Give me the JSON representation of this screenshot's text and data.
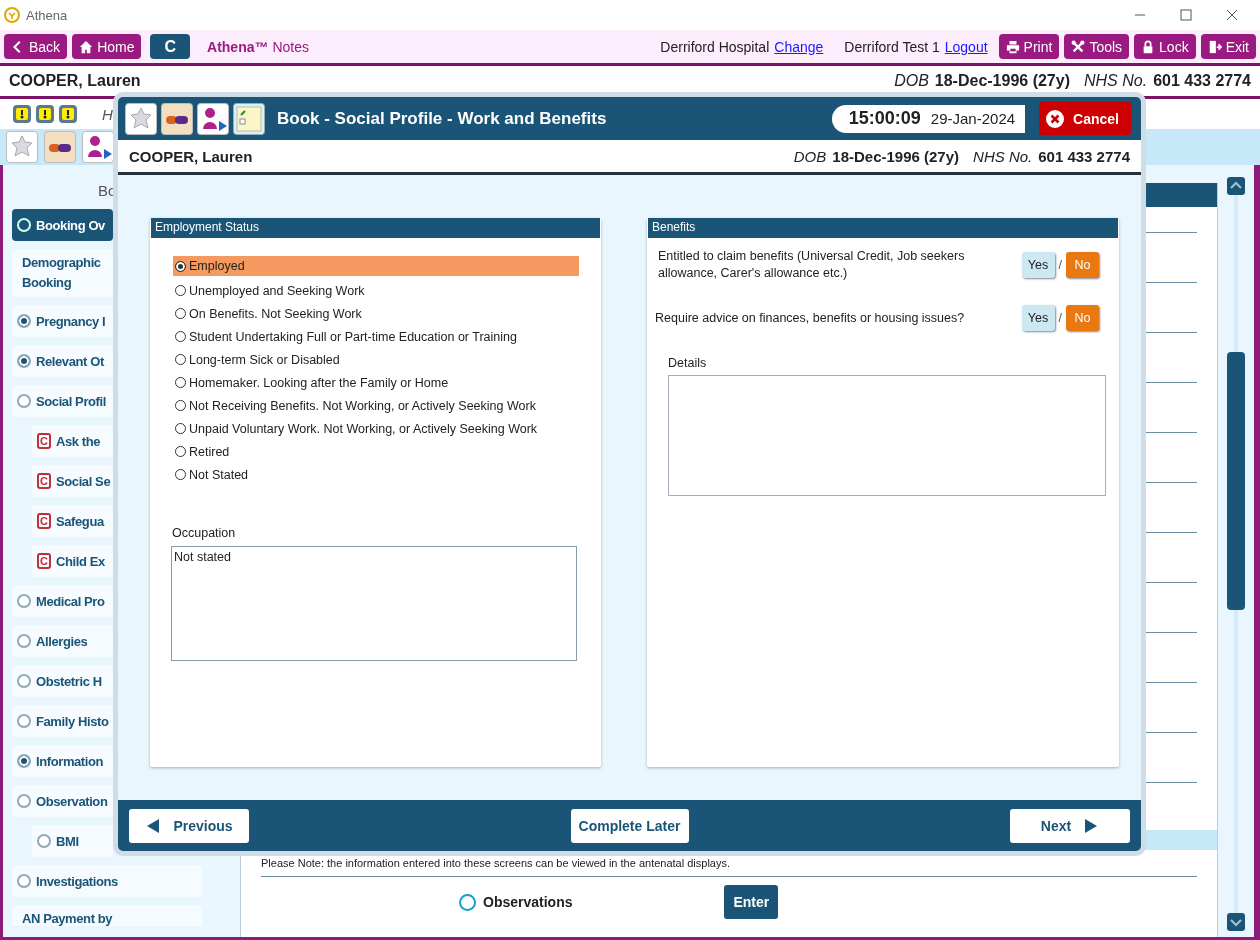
{
  "window": {
    "title": "Athena"
  },
  "toolbar": {
    "left_buttons": [
      {
        "label": "Back"
      },
      {
        "label": "Home"
      },
      {
        "label": "C"
      }
    ],
    "app_name": "Athena™",
    "app_subtitle": "Notes",
    "hospital": "Derriford Hospital",
    "change_link": "Change",
    "user": "Derriford Test 1",
    "logout_link": "Logout",
    "right_buttons": [
      {
        "label": "Print"
      },
      {
        "label": "Tools"
      },
      {
        "label": "Lock"
      },
      {
        "label": "Exit"
      }
    ]
  },
  "patient": {
    "name": "COOPER, Lauren",
    "dob_label": "DOB",
    "dob": "18-Dec-1996 (27y)",
    "nhs_label": "NHS No.",
    "nhs": "601 433 2774"
  },
  "background": {
    "fragment": "H",
    "sidebar_heading": "Bo",
    "sidebar": [
      {
        "label": "Booking Ov",
        "kind": "radio",
        "filled": false,
        "selected": true
      },
      {
        "label": "Demographic Booking",
        "kind": "plain",
        "selected": false
      },
      {
        "label": "Pregnancy I",
        "kind": "radio",
        "filled": true,
        "selected": false
      },
      {
        "label": "Relevant Ot",
        "kind": "radio",
        "filled": true,
        "selected": false
      },
      {
        "label": "Social Profil",
        "kind": "radio",
        "filled": false,
        "selected": false,
        "children": [
          {
            "label": "Ask the",
            "kind": "flag",
            "badge": "C",
            "selected": false
          },
          {
            "label": "Social Se",
            "kind": "flag",
            "badge": "C",
            "selected": false
          },
          {
            "label": "Safegua",
            "kind": "flag",
            "badge": "C",
            "selected": false
          },
          {
            "label": "Child Ex",
            "kind": "flag",
            "badge": "C",
            "selected": false
          }
        ]
      },
      {
        "label": "Medical Pro",
        "kind": "radio",
        "filled": false,
        "selected": false
      },
      {
        "label": "Allergies",
        "kind": "radio",
        "filled": false,
        "selected": false
      },
      {
        "label": "Obstetric H",
        "kind": "radio",
        "filled": false,
        "selected": false
      },
      {
        "label": "Family Histo",
        "kind": "radio",
        "filled": false,
        "selected": false
      },
      {
        "label": "Information",
        "kind": "radio",
        "filled": true,
        "selected": false
      },
      {
        "label": "Observation",
        "kind": "radio",
        "filled": false,
        "selected": false,
        "children": [
          {
            "label": "BMI",
            "kind": "radio",
            "filled": false,
            "selected": false
          }
        ]
      },
      {
        "label": "Investigations",
        "kind": "radio",
        "filled": false,
        "selected": false
      },
      {
        "label": "AN Payment by",
        "kind": "plain",
        "selected": false
      }
    ],
    "note": "Please Note: the information entered into these screens can be viewed in the antenatal displays.",
    "observations": {
      "label": "Observations",
      "checked": false
    },
    "enter_button": "Enter"
  },
  "dialog": {
    "title": "Book - Social Profile - Work and Benefits",
    "time": "15:00:09",
    "date": "29-Jan-2024",
    "cancel": "Cancel",
    "patient": {
      "name": "COOPER, Lauren",
      "dob_label": "DOB",
      "dob": "18-Dec-1996 (27y)",
      "nhs_label": "NHS No.",
      "nhs": "601 433 2774"
    },
    "employment": {
      "title": "Employment Status",
      "options": [
        {
          "label": "Employed",
          "selected": true
        },
        {
          "label": "Unemployed and Seeking Work",
          "selected": false
        },
        {
          "label": "On Benefits. Not Seeking Work",
          "selected": false
        },
        {
          "label": "Student Undertaking Full or Part-time Education or Training",
          "selected": false
        },
        {
          "label": "Long-term Sick or Disabled",
          "selected": false
        },
        {
          "label": "Homemaker. Looking after the Family or Home",
          "selected": false
        },
        {
          "label": "Not Receiving Benefits. Not Working, or Actively Seeking Work",
          "selected": false
        },
        {
          "label": "Unpaid Voluntary Work. Not Working, or Actively Seeking Work",
          "selected": false
        },
        {
          "label": "Retired",
          "selected": false
        },
        {
          "label": "Not Stated",
          "selected": false
        }
      ],
      "occupation_label": "Occupation",
      "occupation_value": "Not stated"
    },
    "benefits": {
      "title": "Benefits",
      "questions": [
        {
          "text": "Entitled to claim benefits (Universal Credit, Job seekers allowance, Carer's allowance etc.)",
          "separator": "/",
          "options": [
            {
              "label": "Yes",
              "selected": false
            },
            {
              "label": "No",
              "selected": true
            }
          ]
        },
        {
          "text": "Require advice on finances, benefits or housing issues?",
          "separator": "/",
          "options": [
            {
              "label": "Yes",
              "selected": false
            },
            {
              "label": "No",
              "selected": true
            }
          ]
        }
      ],
      "details_label": "Details"
    },
    "footer": {
      "previous": "Previous",
      "complete_later": "Complete Later",
      "next": "Next"
    }
  }
}
